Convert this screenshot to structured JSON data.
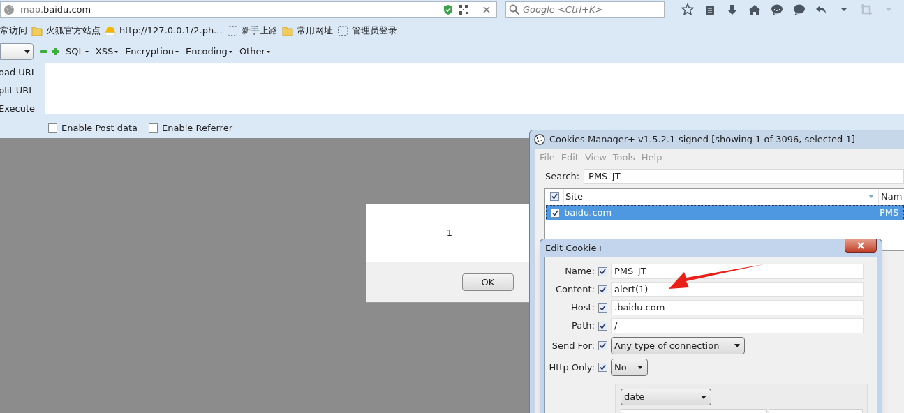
{
  "browser": {
    "url_prefix": "map.",
    "url_host": "baidu.com",
    "search_placeholder": "Google <Ctrl+K>",
    "bookmarks": [
      {
        "label": "常访问",
        "kind": "plain"
      },
      {
        "label": "火狐官方站点",
        "kind": "folder"
      },
      {
        "label": "http://127.0.0.1/2.ph...",
        "kind": "site"
      },
      {
        "label": "新手上路",
        "kind": "page"
      },
      {
        "label": "常用网址",
        "kind": "folder"
      },
      {
        "label": "管理员登录",
        "kind": "page"
      }
    ]
  },
  "hackbar": {
    "menus": [
      "SQL",
      "XSS",
      "Encryption",
      "Encoding",
      "Other"
    ],
    "actions": [
      "oad URL",
      "plit URL",
      "Execute"
    ],
    "options": [
      {
        "label": "Enable Post data",
        "checked": false
      },
      {
        "label": "Enable Referrer",
        "checked": false
      }
    ]
  },
  "alert": {
    "message": "1",
    "button": "OK"
  },
  "cookies_manager": {
    "title": "Cookies Manager+ v1.5.2.1-signed [showing 1 of 3096, selected 1]",
    "menus": [
      {
        "label": "File",
        "disabled": true
      },
      {
        "label": "Edit",
        "disabled": true
      },
      {
        "label": "View",
        "disabled": true
      },
      {
        "label": "Tools",
        "disabled": true
      },
      {
        "label": "Help",
        "disabled": true
      }
    ],
    "search_label": "Search:",
    "search_value": "PMS_JT",
    "header_checked": true,
    "columns": [
      "Site",
      "Nam"
    ],
    "rows": [
      {
        "site": "baidu.com",
        "name": "PMS",
        "checked": true,
        "selected": true
      }
    ]
  },
  "edit_cookie": {
    "title": "Edit Cookie+",
    "fields": [
      {
        "label": "Name:",
        "checked": true,
        "kind": "text",
        "value": "PMS_JT"
      },
      {
        "label": "Content:",
        "checked": true,
        "kind": "text",
        "value": "alert(1)"
      },
      {
        "label": "Host:",
        "checked": true,
        "kind": "text",
        "value": ".baidu.com"
      },
      {
        "label": "Path:",
        "checked": true,
        "kind": "text",
        "value": "/"
      },
      {
        "label": "Send For:",
        "checked": true,
        "kind": "select",
        "value": "Any type of connection"
      },
      {
        "label": "Http Only:",
        "checked": true,
        "kind": "select",
        "value": "No"
      }
    ],
    "expiry_type": "date"
  }
}
